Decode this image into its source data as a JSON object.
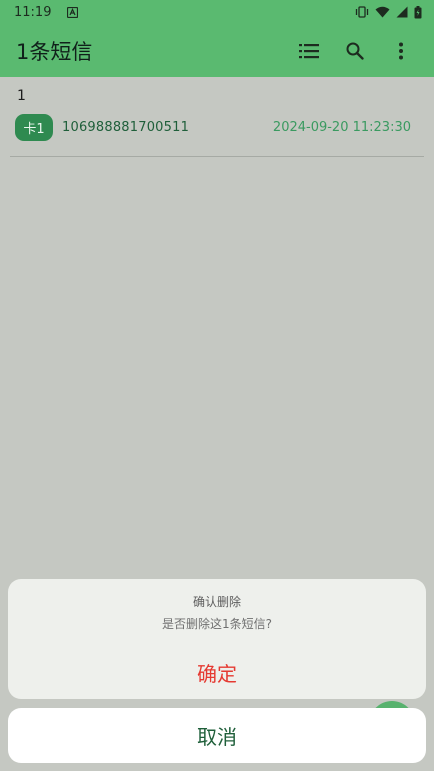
{
  "status_bar": {
    "time": "11:19"
  },
  "app_bar": {
    "title": "1条短信"
  },
  "messages": [
    {
      "body": "1",
      "sim": "卡1",
      "sender": "106988881700511",
      "time": "2024-09-20 11:23:30"
    }
  ],
  "dialog": {
    "title": "确认删除",
    "message": "是否删除这1条短信?",
    "confirm_label": "确定",
    "cancel_label": "取消"
  },
  "colors": {
    "primary": "#5aba70",
    "badge": "#2f8a50",
    "danger": "#e53a32",
    "accent_text": "#3a9a60"
  }
}
